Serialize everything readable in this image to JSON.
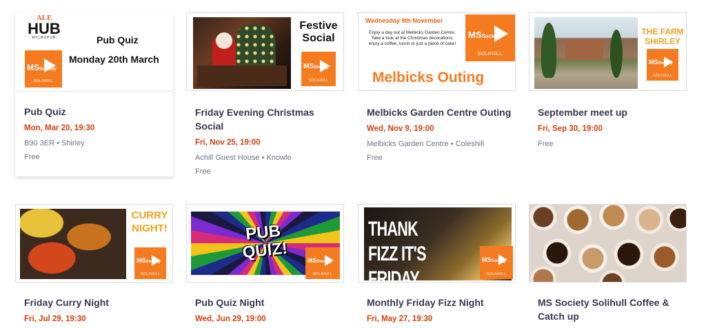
{
  "events": [
    {
      "banner": {
        "brand_top": "ALE",
        "brand_main": "HUB",
        "brand_sub": "MICROPUB",
        "headline": "Pub Quiz",
        "subline": "Monday 20th March"
      },
      "title": "Pub Quiz",
      "date": "Mon, Mar 20, 19:30",
      "location": "B90 3ER • Shirley",
      "price": "Free"
    },
    {
      "banner": {
        "headline": "Festive Social"
      },
      "title": "Friday Evening Christmas Social",
      "date": "Fri, Nov 25, 19:00",
      "location": "Achill Guest House • Knowle",
      "price": "Free"
    },
    {
      "banner": {
        "dateline": "Wednesday 9th November",
        "blurb": "Enjoy a day out at Melbicks Garden Centre. Take a look at the Christmas decorations, enjoy a coffee, lunch or just a piece of cake!",
        "headline": "Melbicks Outing"
      },
      "title": "Melbicks Garden Centre Outing",
      "date": "Wed, Nov 9, 19:00",
      "location": "Melbicks Garden Centre • Coleshill",
      "price": "Free"
    },
    {
      "banner": {
        "headline": "THE FARM SHIRLEY"
      },
      "title": "September meet up",
      "date": "Fri, Sep 30, 19:00",
      "price": "Free"
    },
    {
      "banner": {
        "headline": "CURRY NIGHT!"
      },
      "title": "Friday Curry Night",
      "date": "Fri, Jul 29, 19:30"
    },
    {
      "banner": {
        "headline": "PUB QUIZ!"
      },
      "title": "Pub Quiz Night",
      "date": "Wed, Jun 29, 19:00"
    },
    {
      "banner": {
        "headline": "THANK FIZZ IT'S FRIDAY"
      },
      "title": "Monthly Friday Fizz Night",
      "date": "Fri, May 27, 19:30"
    },
    {
      "banner": {},
      "title": "MS Society Solihull Coffee & Catch up"
    }
  ],
  "logo": {
    "ms": "MS",
    "society": "Society",
    "place": "SOLIHULL"
  },
  "colors": {
    "accent": "#d1410c",
    "brand_orange": "#f47b20",
    "title": "#39364f",
    "muted": "#6f7287"
  }
}
